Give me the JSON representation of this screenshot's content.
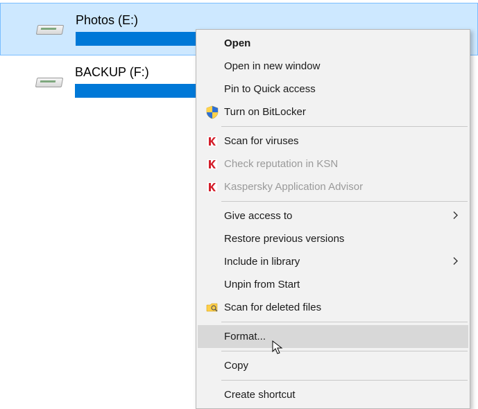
{
  "drives": [
    {
      "label": "Photos (E:)",
      "selected": true
    },
    {
      "label": "BACKUP (F:)",
      "selected": false
    }
  ],
  "menu": {
    "open": "Open",
    "open_new_window": "Open in new window",
    "pin_quick_access": "Pin to Quick access",
    "bitlocker": "Turn on BitLocker",
    "scan_viruses": "Scan for viruses",
    "check_ksn": "Check reputation in KSN",
    "kaspersky_advisor": "Kaspersky Application Advisor",
    "give_access": "Give access to",
    "restore_previous": "Restore previous versions",
    "include_library": "Include in library",
    "unpin_start": "Unpin from Start",
    "scan_deleted": "Scan for deleted files",
    "format": "Format...",
    "copy": "Copy",
    "create_shortcut": "Create shortcut"
  }
}
